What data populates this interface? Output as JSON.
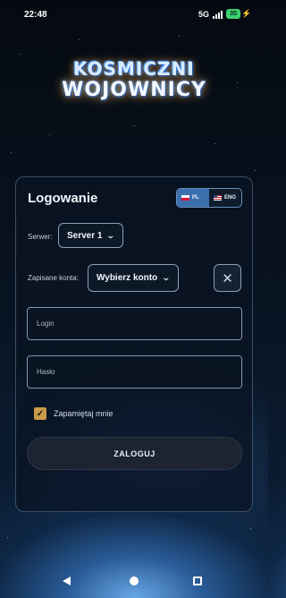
{
  "status_bar": {
    "time": "22:48",
    "network": "5G",
    "battery": "35"
  },
  "logo": {
    "line1": "KOSMICZNI",
    "line2": "WOJOWNICY"
  },
  "login_card": {
    "title": "Logowanie",
    "language": {
      "options": [
        {
          "code": "PL",
          "flag": "poland-flag-icon",
          "selected": true
        },
        {
          "code": "ENG",
          "flag": "us-flag-icon",
          "selected": false
        }
      ]
    },
    "server": {
      "label": "Serwer:",
      "selected": "Server 1"
    },
    "saved_accounts": {
      "label": "Zapisane konta:",
      "selected": "Wybierz konto",
      "clear_icon": "close-icon"
    },
    "login_field": {
      "placeholder": "Login",
      "value": ""
    },
    "password_field": {
      "placeholder": "Hasło",
      "value": ""
    },
    "remember_me": {
      "label": "Zapamiętaj mnie",
      "checked": true
    },
    "submit_label": "ZALOGUJ"
  },
  "colors": {
    "accent_checkbox": "#c99a4a",
    "language_selected": "#3c6fae",
    "battery": "#3bd16f"
  }
}
